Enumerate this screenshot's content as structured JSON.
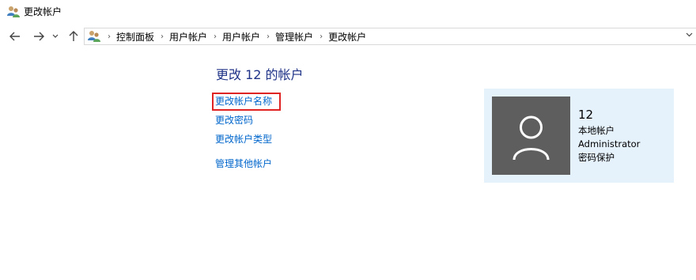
{
  "window": {
    "title": "更改帐户"
  },
  "nav": {
    "breadcrumbs": [
      "控制面板",
      "用户帐户",
      "用户帐户",
      "管理帐户",
      "更改帐户"
    ]
  },
  "main": {
    "heading": "更改 12 的帐户",
    "links": {
      "change_name": "更改帐户名称",
      "change_password": "更改密码",
      "change_type": "更改帐户类型",
      "manage_other": "管理其他帐户"
    }
  },
  "account": {
    "name": "12",
    "type": "本地帐户",
    "role": "Administrator",
    "status": "密码保护"
  },
  "colors": {
    "heading": "#1e3287",
    "link": "#0066cc",
    "panel": "#e5f1fb",
    "highlight": "#e02424"
  }
}
